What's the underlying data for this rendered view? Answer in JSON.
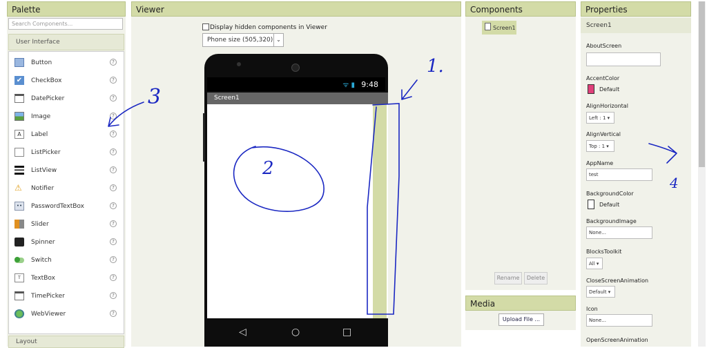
{
  "palette": {
    "title": "Palette",
    "search_placeholder": "Search Components...",
    "category": "User Interface",
    "items": [
      {
        "label": "Button",
        "icon": "button-icon"
      },
      {
        "label": "CheckBox",
        "icon": "checkbox-icon"
      },
      {
        "label": "DatePicker",
        "icon": "datepicker-icon"
      },
      {
        "label": "Image",
        "icon": "image-icon"
      },
      {
        "label": "Label",
        "icon": "label-icon"
      },
      {
        "label": "ListPicker",
        "icon": "listpicker-icon"
      },
      {
        "label": "ListView",
        "icon": "listview-icon"
      },
      {
        "label": "Notifier",
        "icon": "notifier-icon"
      },
      {
        "label": "PasswordTextBox",
        "icon": "password-icon"
      },
      {
        "label": "Slider",
        "icon": "slider-icon"
      },
      {
        "label": "Spinner",
        "icon": "spinner-icon"
      },
      {
        "label": "Switch",
        "icon": "switch-icon"
      },
      {
        "label": "TextBox",
        "icon": "textbox-icon"
      },
      {
        "label": "TimePicker",
        "icon": "timepicker-icon"
      },
      {
        "label": "WebViewer",
        "icon": "webviewer-icon"
      }
    ],
    "help": "?",
    "next_category": "Layout"
  },
  "viewer": {
    "title": "Viewer",
    "hidden_label": "Display hidden components in Viewer",
    "size_value": "Phone size (505,320)",
    "dropdown_arrow": "⌄",
    "screen_title": "Screen1",
    "time": "9:48",
    "status_icons": "ᯤ ▮",
    "nav_back": "◁",
    "nav_home": "○",
    "nav_recent": "□"
  },
  "components": {
    "title": "Components",
    "tree_item": "Screen1",
    "rename": "Rename",
    "delete": "Delete"
  },
  "media": {
    "title": "Media",
    "upload": "Upload File ..."
  },
  "properties": {
    "title": "Properties",
    "selected": "Screen1",
    "about_label": "AboutScreen",
    "accent_label": "AccentColor",
    "accent_value": "Default",
    "accent_color": "#e0407a",
    "alignh_label": "AlignHorizontal",
    "alignh_value": "Left : 1 ▾",
    "alignv_label": "AlignVertical",
    "alignv_value": "Top : 1 ▾",
    "appname_label": "AppName",
    "appname_value": "test",
    "bgcolor_label": "BackgroundColor",
    "bgcolor_value": "Default",
    "bgimage_label": "BackgroundImage",
    "bgimage_value": "None...",
    "blocks_label": "BlocksToolkit",
    "blocks_value": "All ▾",
    "closeanim_label": "CloseScreenAnimation",
    "closeanim_value": "Default ▾",
    "icon_label": "Icon",
    "icon_value": "None...",
    "openanim_label": "OpenScreenAnimation"
  },
  "annotations": [
    "1.",
    "2",
    "3",
    "4"
  ]
}
